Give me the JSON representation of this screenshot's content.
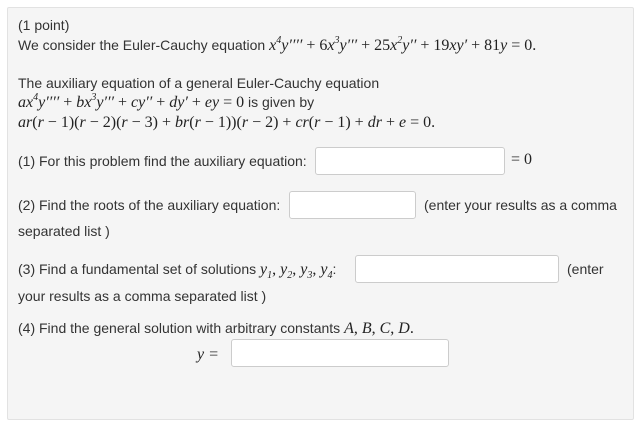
{
  "points": "(1 point)",
  "intro": "We consider the Euler-Cauchy equation",
  "aux_text_1": "The auxiliary equation of a general Euler-Cauchy equation",
  "aux_text_2": "is given by",
  "q1_label": "(1) For this problem find the auxiliary equation:",
  "q1_suffix": "= 0",
  "q2_label": "(2) Find the roots of the auxiliary equation:",
  "q2_hint_1": "(enter your results as a comma",
  "q2_hint_2": "separated list )",
  "q3_label": "(3) Find a fundamental set of solutions",
  "q3_hint_1": "(enter",
  "q3_hint_2": "your results as a comma separated list )",
  "q4_label": "(4) Find the general solution with arbitrary constants",
  "q4_y": "y =",
  "inputs": {
    "q1_value": "",
    "q2_value": "",
    "q3_value": "",
    "q4_value": ""
  }
}
